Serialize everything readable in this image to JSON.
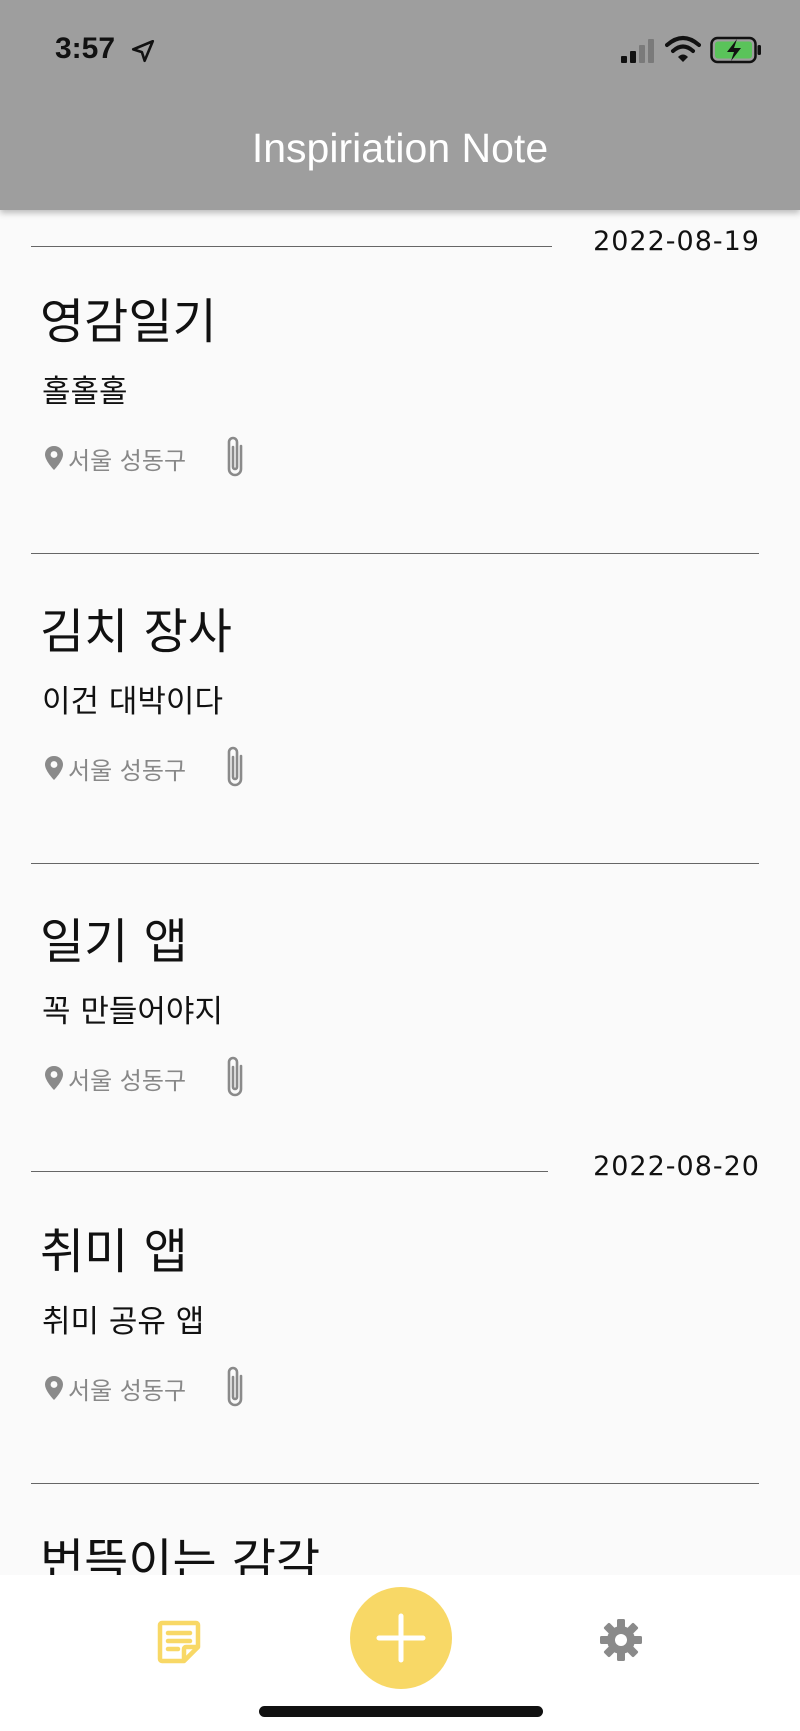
{
  "status_bar": {
    "time": "3:57"
  },
  "app": {
    "title": "Inspiriation Note"
  },
  "groups": [
    {
      "date": "2022-08-19",
      "notes": [
        {
          "title": "영감일기",
          "body": "홀홀홀",
          "location": "서울 성동구"
        },
        {
          "title": "김치 장사",
          "body": "이건 대박이다",
          "location": "서울 성동구"
        },
        {
          "title": "일기 앱",
          "body": "꼭 만들어야지",
          "location": "서울 성동구"
        }
      ]
    },
    {
      "date": "2022-08-20",
      "notes": [
        {
          "title": "취미 앱",
          "body": "취미 공유 앱",
          "location": "서울 성동구"
        },
        {
          "title": "번뜩이는 감각",
          "body": "",
          "location": ""
        }
      ]
    }
  ],
  "icons": {
    "location": "location-pin-icon",
    "attachment": "paperclip-icon",
    "notes_tab": "note-icon",
    "add": "plus-icon",
    "settings": "gear-icon"
  },
  "colors": {
    "app_bar": "#9e9e9e",
    "accent": "#f8d866",
    "background": "#fafafa",
    "meta_text": "#888888"
  }
}
